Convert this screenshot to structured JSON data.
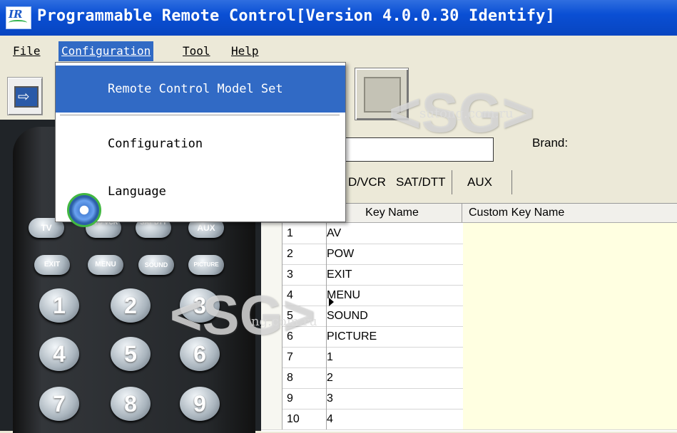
{
  "window": {
    "title": "Programmable Remote Control[Version 4.0.0.30 Identify]",
    "icon": "ir-app-icon",
    "icon_text": "IR"
  },
  "menu": {
    "file": "File",
    "configuration": "Configuration",
    "tool": "Tool",
    "help": "Help"
  },
  "dropdown": {
    "items": [
      {
        "label": "Remote Control Model Set"
      },
      {
        "label": "Configuration",
        "icon": "gear-icon"
      },
      {
        "label": "Language",
        "submenu": true
      }
    ]
  },
  "form": {
    "brand_label": "Brand:"
  },
  "tabs": [
    "D/VCR",
    "SAT/DTT",
    "AUX"
  ],
  "table": {
    "columns": [
      "Key Name",
      "Custom Key Name"
    ],
    "rows": [
      {
        "no": "1",
        "key": "AV"
      },
      {
        "no": "2",
        "key": "POW"
      },
      {
        "no": "3",
        "key": "EXIT"
      },
      {
        "no": "4",
        "key": "MENU"
      },
      {
        "no": "5",
        "key": "SOUND"
      },
      {
        "no": "6",
        "key": "PICTURE"
      },
      {
        "no": "7",
        "key": "1"
      },
      {
        "no": "8",
        "key": "2"
      },
      {
        "no": "9",
        "key": "3"
      },
      {
        "no": "10",
        "key": "4"
      }
    ]
  },
  "remote": {
    "buttons": [
      "TV",
      "DVD VCR",
      "SAT DTT",
      "AUX",
      "EXIT",
      "MENU",
      "SOUND",
      "PICTURE",
      "1",
      "2",
      "3",
      "4",
      "5",
      "6",
      "7",
      "8",
      "9"
    ]
  },
  "watermarks": [
    "<SG>",
    "sutong.com.ru",
    "<SG>",
    "ng.com.ru"
  ]
}
